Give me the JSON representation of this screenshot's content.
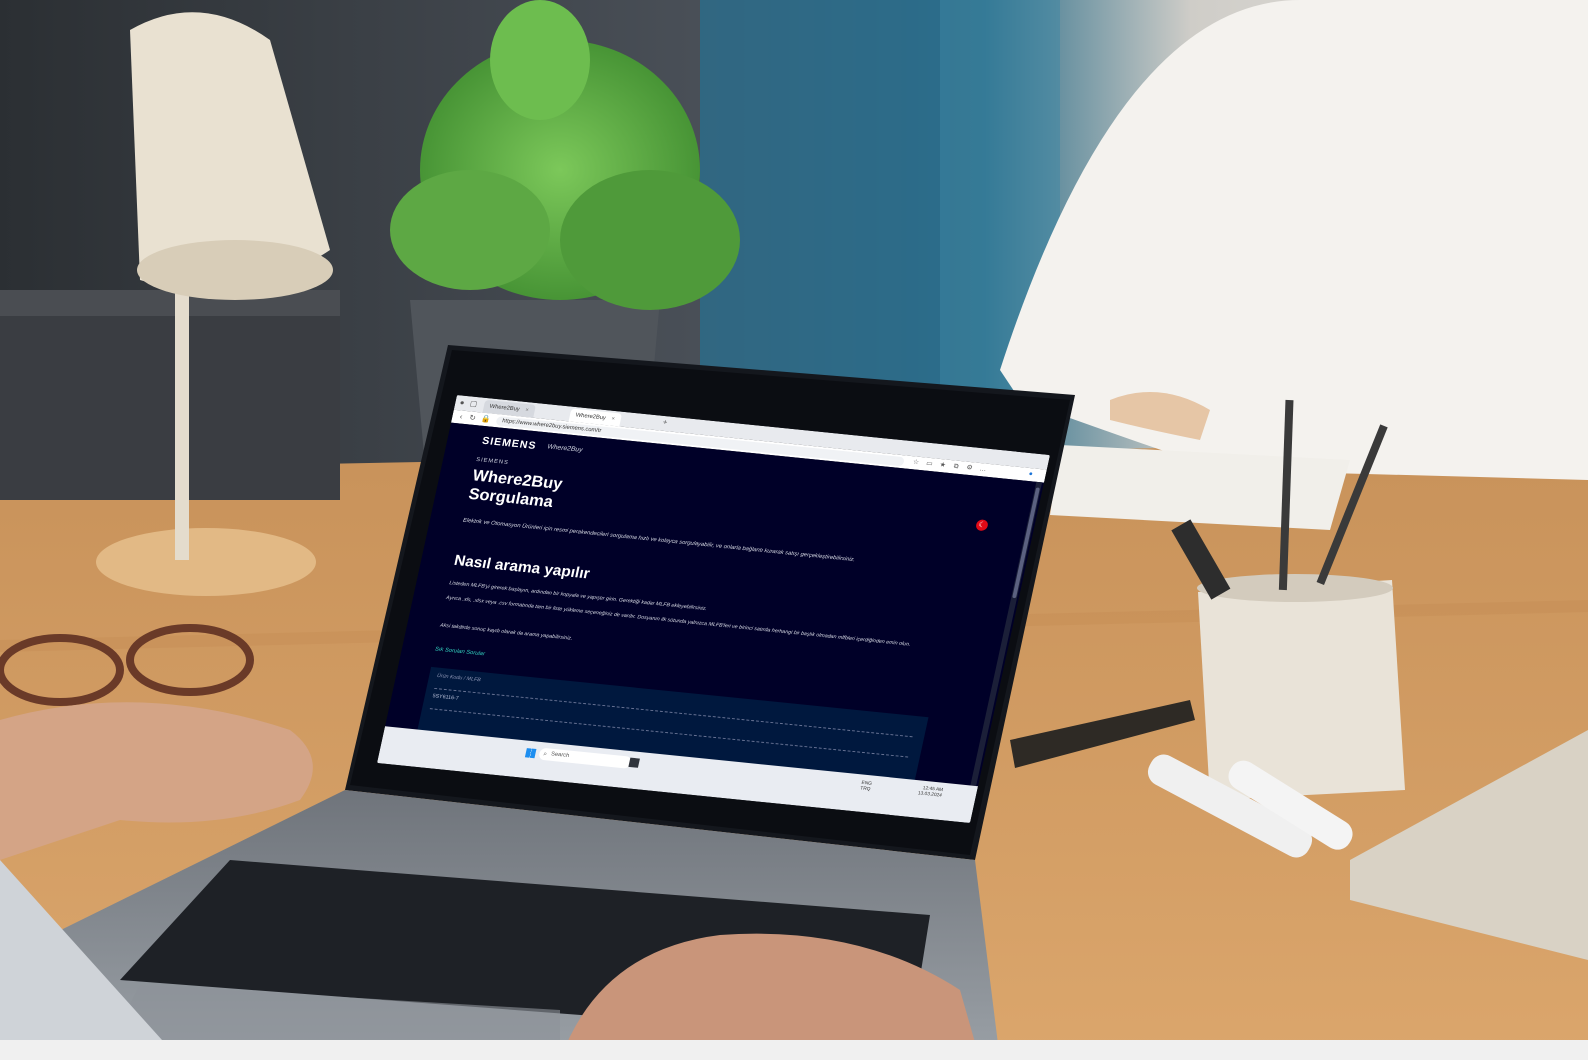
{
  "browser": {
    "tabs": [
      {
        "label": "Where2Buy"
      },
      {
        "label": "Where2Buy"
      }
    ],
    "url": "https://www.where2buy.siemens.com/tr"
  },
  "site": {
    "brand": "SIEMENS",
    "brand_link": "Where2Buy",
    "eyebrow": "SIEMENS",
    "title_line1": "Where2Buy",
    "title_line2": "Sorgulama",
    "intro": "Elektrik ve Otomasyon Ürünleri için resmi perakendecileri sorgulama hızlı ve kolayca sorgulayabilir, ve onlarla bağlantı kurarak satışı gerçekleştirebilirsiniz.",
    "how_title": "Nasıl arama yapılır",
    "steps": [
      "Listeden MLFB'yi girerek başlayın, ardından bir kopyala ve yapıştır girin. Gerektiği kadar MLFB ekleyebilirsiniz.",
      "Ayrıca .xls, .xlsx veya .csv formatında tam bir liste yükleme seçeneğiniz de vardır. Dosyanın ilk sütunda yalnızca MLFB'leri ve birinci satırda herhangi bir başlık olmadan mlfbleri içerdiğinden emin olun.",
      "Aksi takdirde sonuç kaydı olarak da arama yapabilirsiniz."
    ],
    "link": "Sık Sorulan Sorular",
    "panel_label": "Ürün Kodu / MLFB",
    "panel_value": "5SY6116-7"
  },
  "taskbar": {
    "search_placeholder": "Search",
    "tray_lang": "ENG",
    "tray_region": "TRQ",
    "time": "12:45 AM",
    "date": "13.03.2024"
  },
  "colors": {
    "page_bg": "#000028",
    "accent_link": "#33d6c4",
    "flag": "#e30a17"
  }
}
